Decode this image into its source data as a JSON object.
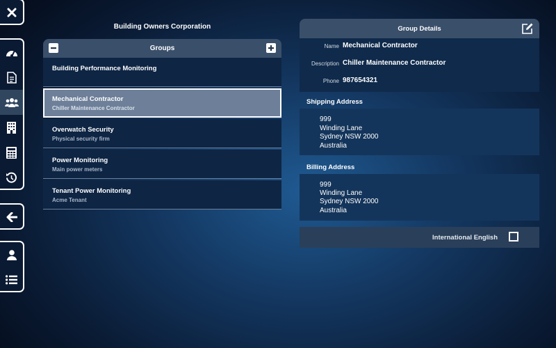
{
  "sidebar": {
    "items": [
      {
        "icon": "close-icon"
      },
      {
        "icon": "dashboard-icon"
      },
      {
        "icon": "document-icon"
      },
      {
        "icon": "groups-icon"
      },
      {
        "icon": "building-icon"
      },
      {
        "icon": "calculator-icon"
      },
      {
        "icon": "refresh-icon"
      },
      {
        "icon": "back-arrow-icon"
      },
      {
        "icon": "user-icon"
      },
      {
        "icon": "list-icon"
      }
    ],
    "active": "groups-icon"
  },
  "corporation": "Building Owners Corporation",
  "groups": {
    "title": "Groups",
    "items": [
      {
        "name": "Building Performance Monitoring",
        "desc": ""
      },
      {
        "name": "Mechanical Contractor",
        "desc": "Chiller Maintenance Contractor",
        "selected": true
      },
      {
        "name": "Overwatch Security",
        "desc": "Physical security firm"
      },
      {
        "name": "Power Monitoring",
        "desc": "Main power meters"
      },
      {
        "name": "Tenant Power Monitoring",
        "desc": "Acme Tenant"
      }
    ]
  },
  "details": {
    "title": "Group Details",
    "name_label": "Name",
    "name": "Mechanical Contractor",
    "description_label": "Description",
    "description": "Chiller Maintenance Contractor",
    "phone_label": "Phone",
    "phone": "987654321",
    "shipping_label": "Shipping Address",
    "shipping": [
      "999",
      "Winding Lane",
      "Sydney NSW 2000",
      "Australia"
    ],
    "billing_label": "Billing Address",
    "billing": [
      "999",
      "Winding Lane",
      "Sydney NSW 2000",
      "Australia"
    ],
    "intl_label": "International English",
    "intl_checked": false
  },
  "colors": {
    "panel_header": "#3a4f6a",
    "selected_row": "#6d7f99",
    "row": "#0e2544"
  }
}
